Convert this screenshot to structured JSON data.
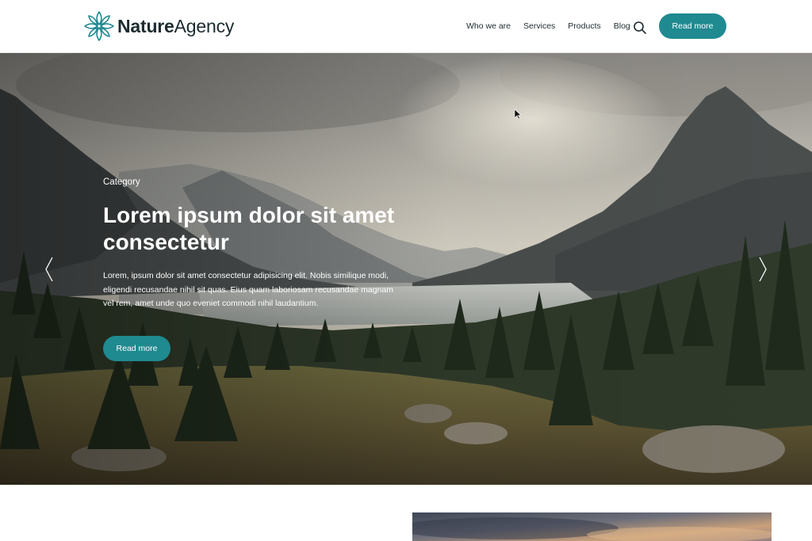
{
  "brand": {
    "name_bold": "Nature",
    "name_light": "Agency",
    "logo_icon": "lotus-mandala-icon",
    "accent": "#1f8a90"
  },
  "nav": {
    "items": [
      {
        "label": "Who we are"
      },
      {
        "label": "Services"
      },
      {
        "label": "Products"
      },
      {
        "label": "Blog"
      }
    ],
    "search_icon": "search-icon",
    "cta_label": "Read more"
  },
  "hero": {
    "category": "Category",
    "title": "Lorem ipsum dolor sit amet consectetur",
    "text": "Lorem, ipsum dolor sit amet consectetur adipisicing elit. Nobis similique modi, eligendi recusandae nihil sit quas. Eius quam laboriosam recusandae magnam vel rem, amet unde quo eveniet commodi nihil laudantium.",
    "button_label": "Read more",
    "prev_icon": "chevron-left-icon",
    "next_icon": "chevron-right-icon"
  }
}
